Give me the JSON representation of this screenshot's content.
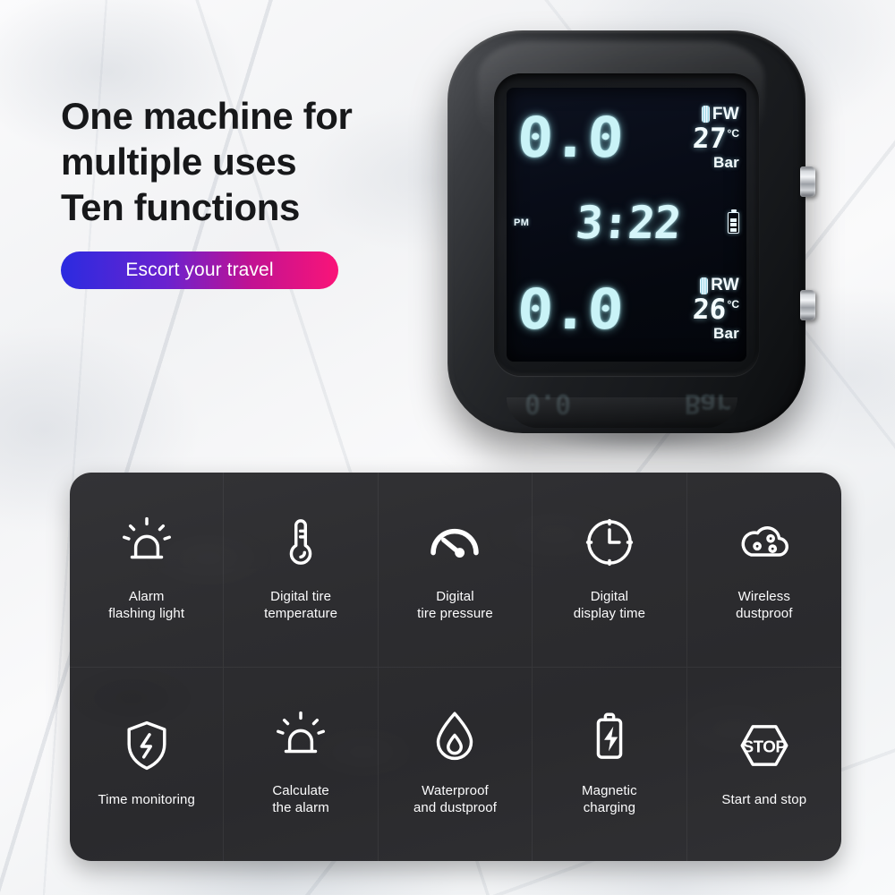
{
  "headline": {
    "line1": "One machine for",
    "line2": "multiple uses",
    "line3": "Ten functions"
  },
  "pill": {
    "label": "Escort your travel",
    "gradient_from": "#2b2be0",
    "gradient_to": "#fa1478"
  },
  "device": {
    "lcd": {
      "front": {
        "pressure": "0.0",
        "wheel_label": "FW",
        "temperature": "27",
        "temp_unit": "°C",
        "pressure_unit": "Bar"
      },
      "time": {
        "meridiem": "PM",
        "value": "3:22",
        "battery_segments": 3
      },
      "rear": {
        "pressure": "0.0",
        "wheel_label": "RW",
        "temperature": "26",
        "temp_unit": "°C",
        "pressure_unit": "Bar"
      },
      "glow_color": "#c9f3f7",
      "background_color": "#05080f"
    },
    "body_color": "#1c1e21",
    "buttons": [
      "side-button-upper",
      "side-button-lower"
    ]
  },
  "features": {
    "panel_color": "#2e2e30",
    "items": [
      {
        "icon": "alarm-beacon-icon",
        "label": "Alarm\nflashing light"
      },
      {
        "icon": "thermometer-icon",
        "label": "Digital tire\ntemperature"
      },
      {
        "icon": "pressure-gauge-icon",
        "label": "Digital\ntire pressure"
      },
      {
        "icon": "clock-icon",
        "label": "Digital\ndisplay time"
      },
      {
        "icon": "dust-cloud-icon",
        "label": "Wireless\ndustproof"
      },
      {
        "icon": "shield-bolt-icon",
        "label": "Time monitoring"
      },
      {
        "icon": "alarm-beacon-icon",
        "label": "Calculate\nthe alarm"
      },
      {
        "icon": "water-drop-icon",
        "label": "Waterproof\nand dustproof"
      },
      {
        "icon": "battery-bolt-icon",
        "label": "Magnetic\ncharging"
      },
      {
        "icon": "stop-sign-icon",
        "label": "Start and stop"
      }
    ]
  }
}
